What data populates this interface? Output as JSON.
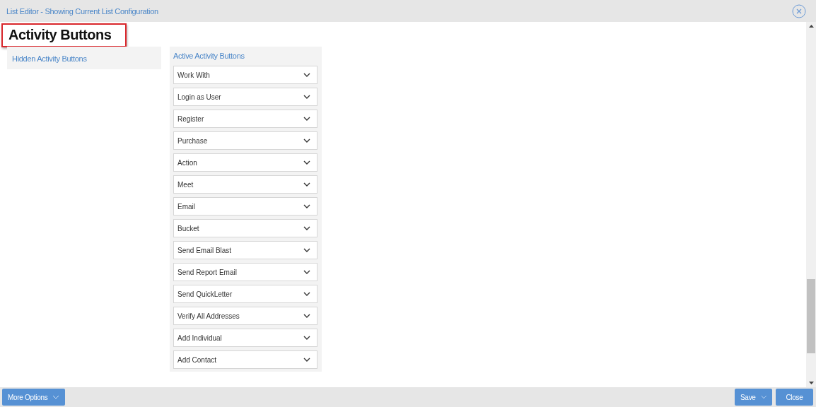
{
  "window": {
    "title": "List Editor - Showing Current List Configuration"
  },
  "heading": "Activity Buttons",
  "hidden_panel": {
    "title": "Hidden Activity Buttons"
  },
  "active_panel": {
    "title": "Active Activity Buttons",
    "items": [
      {
        "label": "Work With"
      },
      {
        "label": "Login as User"
      },
      {
        "label": "Register"
      },
      {
        "label": "Purchase"
      },
      {
        "label": "Action"
      },
      {
        "label": "Meet"
      },
      {
        "label": "Email"
      },
      {
        "label": "Bucket"
      },
      {
        "label": "Send Email Blast"
      },
      {
        "label": "Send Report Email"
      },
      {
        "label": "Send QuickLetter"
      },
      {
        "label": "Verify All Addresses"
      },
      {
        "label": "Add Individual"
      },
      {
        "label": "Add Contact"
      }
    ]
  },
  "footer": {
    "more_options": "More Options",
    "save": "Save",
    "close": "Close"
  }
}
